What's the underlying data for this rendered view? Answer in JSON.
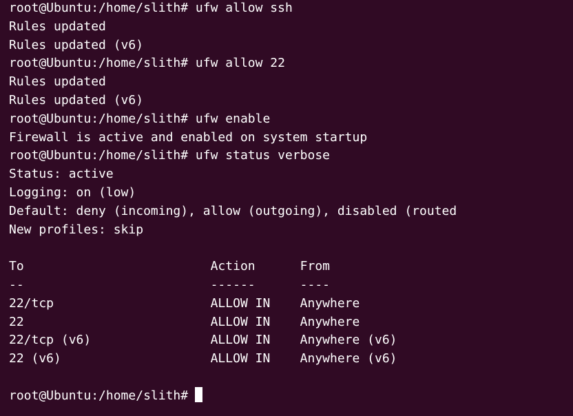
{
  "terminal": {
    "lines": [
      "root@Ubuntu:/home/slith# ufw allow ssh",
      "Rules updated",
      "Rules updated (v6)",
      "root@Ubuntu:/home/slith# ufw allow 22",
      "Rules updated",
      "Rules updated (v6)",
      "root@Ubuntu:/home/slith# ufw enable",
      "Firewall is active and enabled on system startup",
      "root@Ubuntu:/home/slith# ufw status verbose",
      "Status: active",
      "Logging: on (low)",
      "Default: deny (incoming), allow (outgoing), disabled (routed",
      "New profiles: skip",
      "",
      "To                         Action      From",
      "--                         ------      ----",
      "22/tcp                     ALLOW IN    Anywhere",
      "22                         ALLOW IN    Anywhere",
      "22/tcp (v6)                ALLOW IN    Anywhere (v6)",
      "22 (v6)                    ALLOW IN    Anywhere (v6)",
      ""
    ],
    "prompt": "root@Ubuntu:/home/slith#",
    "colors": {
      "background": "#300a24",
      "foreground": "#ffffff"
    }
  }
}
